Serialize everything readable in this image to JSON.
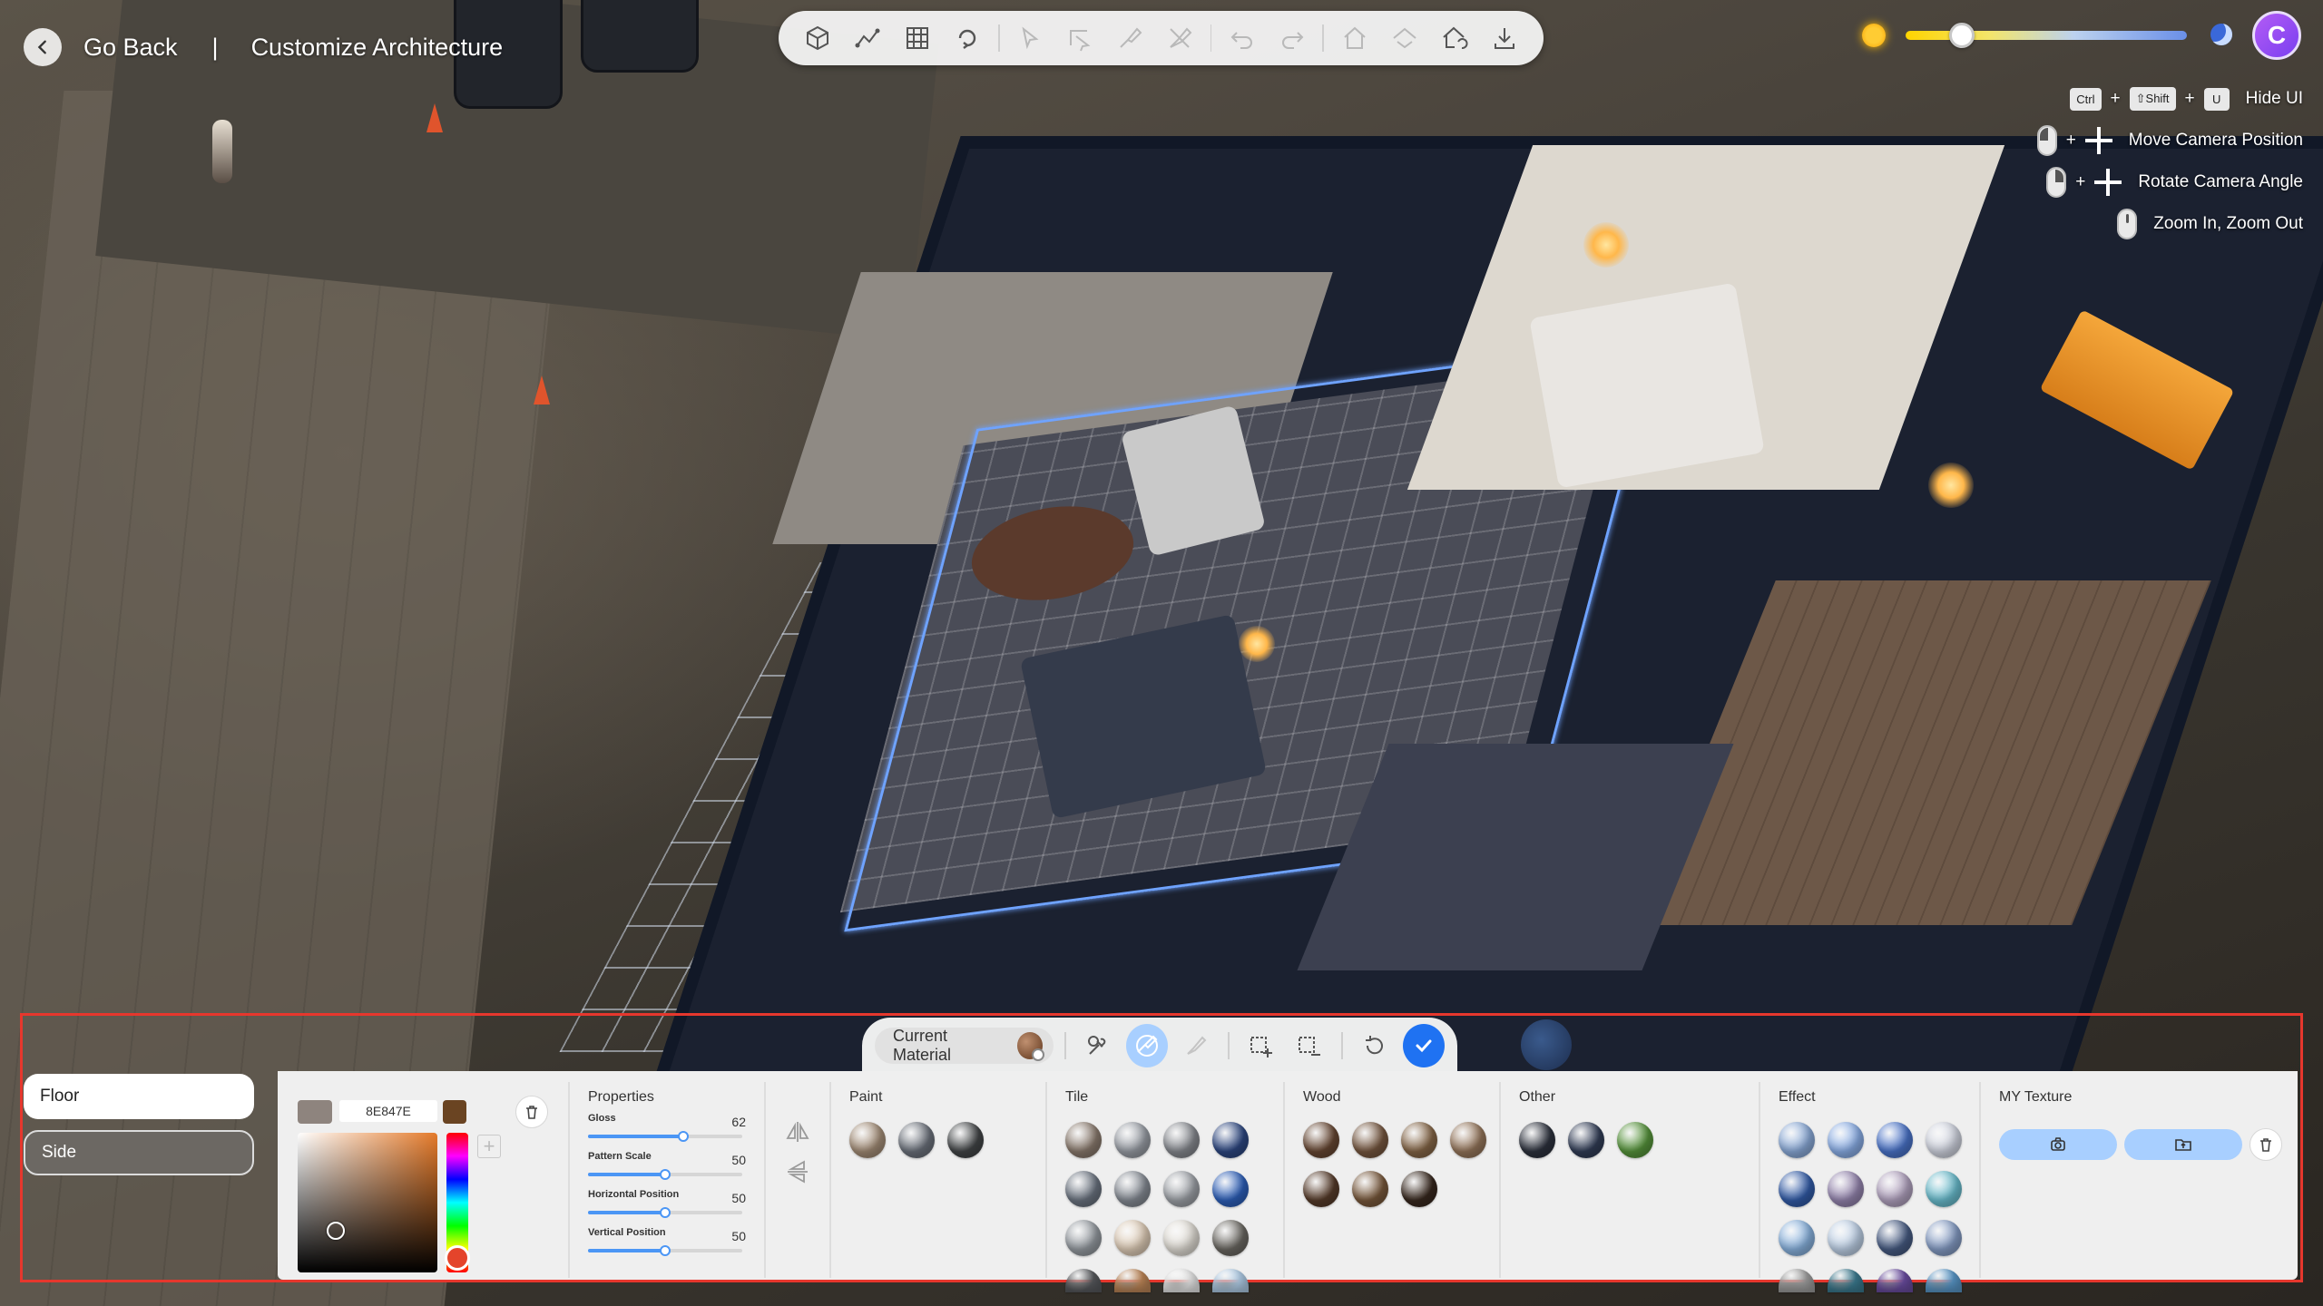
{
  "header": {
    "back_label": "Go Back",
    "separator": "|",
    "title": "Customize Architecture"
  },
  "toolbar": {
    "buttons": [
      {
        "icon": "view-3d-icon"
      },
      {
        "icon": "draw-wall-icon"
      },
      {
        "icon": "grid-icon"
      },
      {
        "icon": "rotate-hand-icon"
      },
      {
        "icon": "select-arrow-icon",
        "disabled": true
      },
      {
        "icon": "select-area-icon",
        "disabled": true
      },
      {
        "icon": "paint-tool-icon",
        "disabled": true
      },
      {
        "icon": "erase-paint-icon",
        "disabled": true
      },
      {
        "icon": "undo-icon",
        "disabled": true
      },
      {
        "icon": "redo-icon",
        "disabled": true
      },
      {
        "icon": "house-cut-icon",
        "disabled": true
      },
      {
        "icon": "house-level-icon",
        "disabled": true
      },
      {
        "icon": "house-reset-icon"
      },
      {
        "icon": "download-icon"
      }
    ]
  },
  "daylight": {
    "level": 0.2,
    "start_icon": "sun-icon",
    "end_icon": "moon-icon"
  },
  "user": {
    "avatar_letter": "C",
    "avatar_color": "#9b4ef5"
  },
  "hints": [
    {
      "keys": [
        "Ctrl",
        "⇧Shift",
        "U"
      ],
      "label": "Hide UI"
    },
    {
      "mouse": "left",
      "label": "Move Camera Position"
    },
    {
      "mouse": "right",
      "label": "Rotate Camera Angle"
    },
    {
      "mouse": "wheel",
      "label": "Zoom In, Zoom Out"
    }
  ],
  "mode_bar": {
    "current_material_label": "Current Material",
    "tools": [
      "eyedropper-icon",
      "paint-area-icon",
      "brush-icon",
      "add-select-icon",
      "remove-select-icon",
      "reset-icon",
      "confirm-icon"
    ]
  },
  "side_tabs": [
    {
      "label": "Floor",
      "active": true
    },
    {
      "label": "Side",
      "active": false
    }
  ],
  "color_picker": {
    "current_swatch": "#8E847E",
    "hex_value": "8E847E",
    "accent_swatch": "#6a4422",
    "hue_color": "#e47a2a"
  },
  "properties": {
    "title": "Properties",
    "items": [
      {
        "label": "Gloss",
        "value": "62",
        "fraction": 0.62
      },
      {
        "label": "Pattern Scale",
        "value": "50",
        "fraction": 0.5
      },
      {
        "label": "Horizontal Position",
        "value": "50",
        "fraction": 0.5
      },
      {
        "label": "Vertical Position",
        "value": "50",
        "fraction": 0.5
      }
    ]
  },
  "materials": {
    "paint": {
      "title": "Paint",
      "colors": [
        "#a8917a",
        "#707680",
        "#45484a"
      ]
    },
    "tile": {
      "title": "Tile",
      "colors": [
        "#8f7f72",
        "#9ea3ab",
        "#8b8e94",
        "#2f4a86",
        "#6f7885",
        "#8a9099",
        "#a3a7ad",
        "#2f63c0",
        "#9aa0a6",
        "#e6d3bd",
        "#e8e4dc",
        "#6f6c66",
        "#5a5c60",
        "#c38a5a",
        "#f0f0f0",
        "#b6d4ef"
      ]
    },
    "wood": {
      "title": "Wood",
      "colors": [
        "#6b4a35",
        "#7a5a42",
        "#8a6a4a",
        "#9a7a5e",
        "#5a3e2c",
        "#7d5c3e",
        "#3a2a20"
      ]
    },
    "other": {
      "title": "Other",
      "colors": [
        "#2f3440",
        "#34405a",
        "#5a9a3e"
      ]
    },
    "effect": {
      "title": "Effect",
      "colors": [
        "#8fb0e0",
        "#8fb4ef",
        "#4d78d1",
        "#d8dce8",
        "#345fae",
        "#9a8ab5",
        "#b8a8c6",
        "#6ec4d6",
        "#8db8e6",
        "#c5d8ef",
        "#4a5f88",
        "#8aa2cc",
        "#a3a3a3",
        "#3d7f95",
        "#6e4fa6",
        "#5c9ccf"
      ]
    },
    "my_texture": {
      "title": "MY Texture"
    }
  },
  "accent": "#1f72f2",
  "highlight_border": "#e6372d"
}
